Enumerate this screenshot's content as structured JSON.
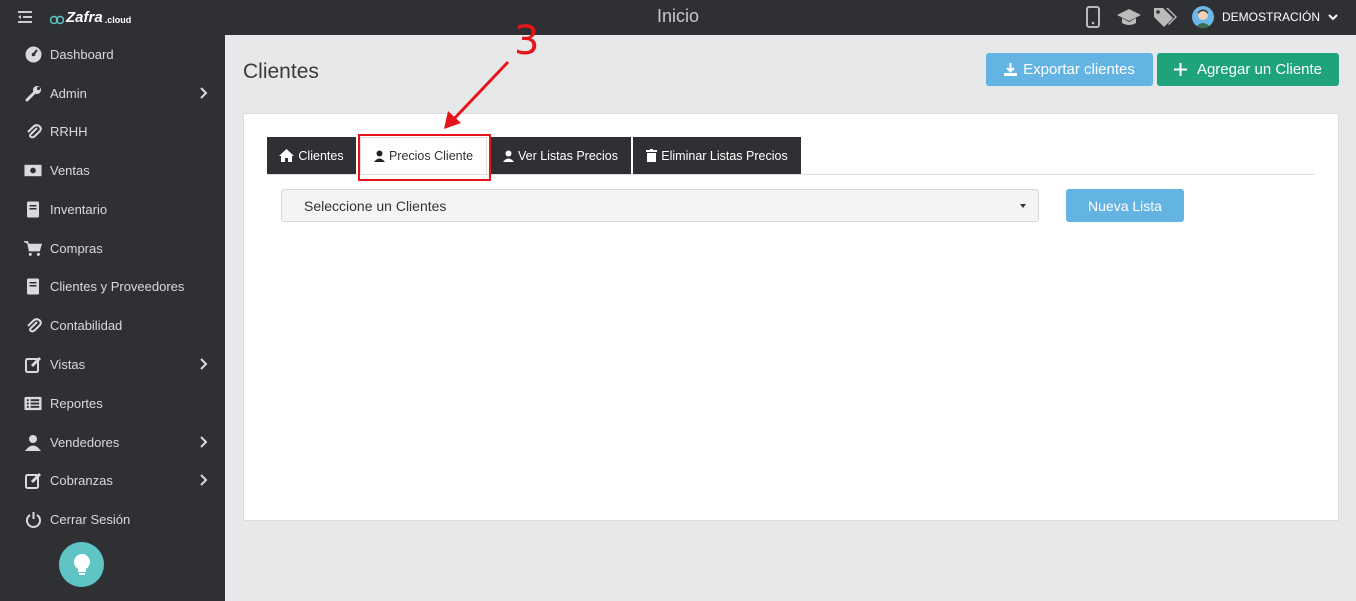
{
  "topbar": {
    "title": "Inicio",
    "logo_text": "Zafra",
    "logo_sub": ".cloud",
    "user_name": "DEMOSTRACIÓN",
    "icons": [
      "menu-toggle-icon",
      "mobile-icon",
      "graduation-cap-icon",
      "tags-icon"
    ]
  },
  "sidebar": {
    "items": [
      {
        "label": "Dashboard",
        "icon": "dashboard-icon",
        "submenu": false
      },
      {
        "label": "Admin",
        "icon": "wrench-icon",
        "submenu": true
      },
      {
        "label": "RRHH",
        "icon": "paperclip-icon",
        "submenu": false
      },
      {
        "label": "Ventas",
        "icon": "money-icon",
        "submenu": false
      },
      {
        "label": "Inventario",
        "icon": "book-icon",
        "submenu": false
      },
      {
        "label": "Compras",
        "icon": "cart-icon",
        "submenu": false
      },
      {
        "label": "Clientes y Proveedores",
        "icon": "book-icon",
        "submenu": false
      },
      {
        "label": "Contabilidad",
        "icon": "paperclip-icon",
        "submenu": false
      },
      {
        "label": "Vistas",
        "icon": "edit-icon",
        "submenu": true
      },
      {
        "label": "Reportes",
        "icon": "list-icon",
        "submenu": false
      },
      {
        "label": "Vendedores",
        "icon": "user-icon",
        "submenu": true
      },
      {
        "label": "Cobranzas",
        "icon": "edit-icon",
        "submenu": true
      },
      {
        "label": "Cerrar Sesión",
        "icon": "power-icon",
        "submenu": false
      }
    ]
  },
  "main": {
    "title": "Clientes",
    "export_label": "Exportar clientes",
    "add_label": "Agregar un Cliente",
    "tabs": [
      {
        "label": "Clientes",
        "icon": "home-icon"
      },
      {
        "label": "Precios Cliente",
        "icon": "user-icon",
        "active": true
      },
      {
        "label": "Ver Listas Precios",
        "icon": "user-icon"
      },
      {
        "label": "Eliminar Listas Precios",
        "icon": "trash-icon"
      }
    ],
    "select_placeholder": "Seleccione un Clientes",
    "new_list_label": "Nueva Lista"
  },
  "annotation": {
    "number": "3",
    "color": "#e8141b"
  },
  "colors": {
    "dark": "#2f3033",
    "primary_light": "#63b3e3",
    "success": "#1fa37a",
    "accent": "#5ec4c4"
  }
}
